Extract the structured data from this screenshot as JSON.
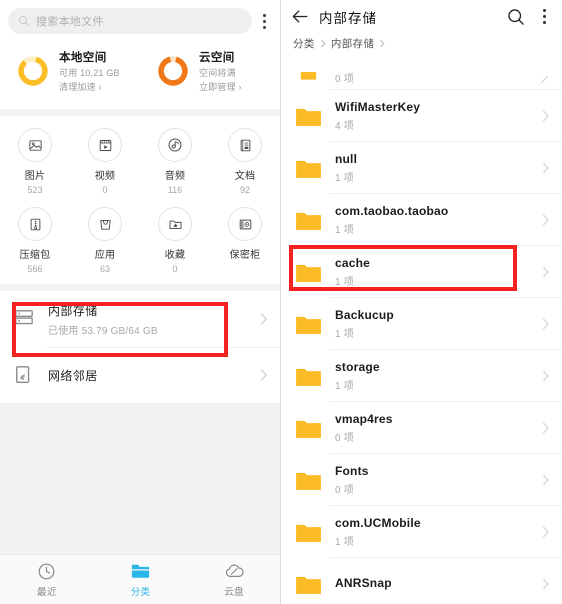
{
  "left": {
    "search": {
      "placeholder": "搜索本地文件",
      "icon": "search-icon"
    },
    "overflow_icon": "more-vertical-icon",
    "storage_cards": [
      {
        "title": "本地空间",
        "subtitle": "可用 10.21 GB",
        "action": "清理加速",
        "arrow": "›",
        "ring_color": "#fcbf27",
        "ring_track": "#fdf0c7",
        "percent": 84
      },
      {
        "title": "云空间",
        "subtitle": "空间将满",
        "action": "立即管理",
        "arrow": "›",
        "ring_color": "#f07818",
        "ring_track": "#fae3cd",
        "percent": 92
      }
    ],
    "categories": [
      {
        "name": "图片",
        "count": "523",
        "icon": "image-icon"
      },
      {
        "name": "视频",
        "count": "0",
        "icon": "video-icon"
      },
      {
        "name": "音频",
        "count": "116",
        "icon": "audio-icon"
      },
      {
        "name": "文档",
        "count": "92",
        "icon": "document-icon"
      },
      {
        "name": "压缩包",
        "count": "566",
        "icon": "zip-icon"
      },
      {
        "name": "应用",
        "count": "63",
        "icon": "apk-icon"
      },
      {
        "name": "收藏",
        "count": "0",
        "icon": "favorite-folder-icon"
      },
      {
        "name": "保密柜",
        "count": "",
        "icon": "safe-icon"
      }
    ],
    "storage_rows": [
      {
        "title": "内部存储",
        "subtitle": "已使用 53.79 GB/64 GB",
        "icon": "internal-storage-icon",
        "highlighted": true
      },
      {
        "title": "网络邻居",
        "subtitle": "",
        "icon": "network-neighbor-icon",
        "highlighted": false
      }
    ],
    "bottom_nav": [
      {
        "label": "最近",
        "icon": "clock-icon",
        "active": false
      },
      {
        "label": "分类",
        "icon": "folder-icon",
        "active": true
      },
      {
        "label": "云盘",
        "icon": "cloud-icon",
        "active": false
      }
    ]
  },
  "right": {
    "header": {
      "back_icon": "back-arrow-icon",
      "title": "内部存储",
      "search_icon": "search-icon",
      "overflow_icon": "more-vertical-icon"
    },
    "breadcrumb": [
      "分类",
      "内部存储"
    ],
    "files": [
      {
        "name": "",
        "count": "0 项",
        "icon": "folder-icon",
        "partial": true,
        "trailing": "pencil-icon",
        "highlighted": false
      },
      {
        "name": "WifiMasterKey",
        "count": "4 项",
        "icon": "folder-icon",
        "partial": false,
        "trailing": "chevron-right-icon",
        "highlighted": false
      },
      {
        "name": "null",
        "count": "1 项",
        "icon": "folder-icon",
        "partial": false,
        "trailing": "chevron-right-icon",
        "highlighted": false
      },
      {
        "name": "com.taobao.taobao",
        "count": "1 项",
        "icon": "folder-icon",
        "partial": false,
        "trailing": "chevron-right-icon",
        "highlighted": false
      },
      {
        "name": "cache",
        "count": "1 项",
        "icon": "folder-icon",
        "partial": false,
        "trailing": "chevron-right-icon",
        "highlighted": true
      },
      {
        "name": "Backucup",
        "count": "1 项",
        "icon": "folder-icon",
        "partial": false,
        "trailing": "chevron-right-icon",
        "highlighted": false
      },
      {
        "name": "storage",
        "count": "1 项",
        "icon": "folder-icon",
        "partial": false,
        "trailing": "chevron-right-icon",
        "highlighted": false
      },
      {
        "name": "vmap4res",
        "count": "0 项",
        "icon": "folder-icon",
        "partial": false,
        "trailing": "chevron-right-icon",
        "highlighted": false
      },
      {
        "name": "Fonts",
        "count": "0 项",
        "icon": "folder-icon",
        "partial": false,
        "trailing": "chevron-right-icon",
        "highlighted": false
      },
      {
        "name": "com.UCMobile",
        "count": "1 项",
        "icon": "folder-icon",
        "partial": false,
        "trailing": "chevron-right-icon",
        "highlighted": false
      },
      {
        "name": "ANRSnap",
        "count": "",
        "icon": "folder-icon",
        "partial": false,
        "trailing": "chevron-right-icon",
        "highlighted": false
      }
    ]
  },
  "annotations": {
    "highlight_color": "#f42121",
    "boxes": [
      {
        "name": "internal-storage-highlight"
      },
      {
        "name": "cache-folder-highlight"
      }
    ]
  }
}
